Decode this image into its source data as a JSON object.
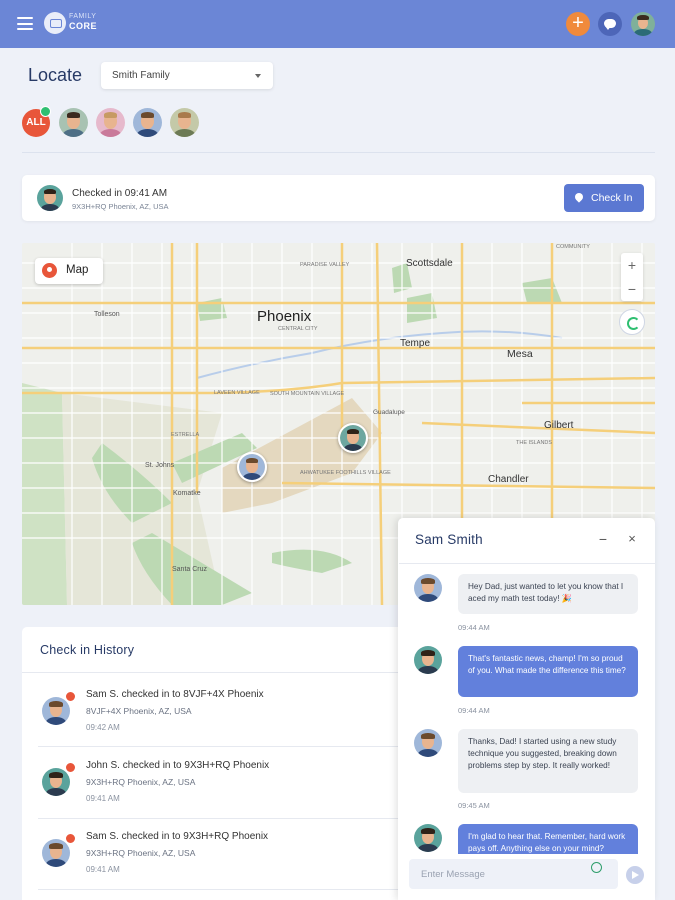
{
  "app": {
    "logo_line1": "FAMILY",
    "logo_line2": "CORE",
    "accent_color": "#6b86d6"
  },
  "header": {
    "menu_icon": "hamburger-icon",
    "plus_symbol": "+",
    "chat_icon": "chat-bubble-icon"
  },
  "locate": {
    "title": "Locate",
    "selected_family": "Smith Family",
    "all_label": "ALL"
  },
  "checkin": {
    "title": "Checked in 09:41 AM",
    "address": "9X3H+RQ Phoenix, AZ, USA",
    "button_label": "Check In"
  },
  "map": {
    "chip_label": "Map",
    "zoom_in": "+",
    "zoom_out": "−",
    "labels": {
      "phoenix": "Phoenix",
      "scottsdale": "Scottsdale",
      "tempe": "Tempe",
      "mesa": "Mesa",
      "gilbert": "Gilbert",
      "chandler": "Chandler",
      "tolleson": "Tolleson",
      "st_johns": "St. Johns",
      "komatke": "Komatke",
      "santa_cruz": "Santa Cruz",
      "guadalupe": "Guadalupe",
      "central_city": "CENTRAL CITY",
      "community": "COMMUNITY",
      "paradise_valley": "PARADISE VALLEY",
      "estrella": "ESTRELLA",
      "laveen": "LAVEEN VILLAGE",
      "south_mountain": "SOUTH MOUNTAIN VILLAGE",
      "the_islands": "THE ISLANDS",
      "ahwatukee": "AHWATUKEE FOOTHILLS VILLAGE"
    }
  },
  "history": {
    "title": "Check in History",
    "items": [
      {
        "title": "Sam S. checked in to 8VJF+4X Phoenix",
        "address": "8VJF+4X Phoenix, AZ, USA",
        "time": "09:42 AM"
      },
      {
        "title": "John S. checked in to 9X3H+RQ Phoenix",
        "address": "9X3H+RQ Phoenix, AZ, USA",
        "time": "09:41 AM"
      },
      {
        "title": "Sam S. checked in to 9X3H+RQ Phoenix",
        "address": "9X3H+RQ Phoenix, AZ, USA",
        "time": "09:41 AM"
      }
    ]
  },
  "chat": {
    "name": "Sam Smith",
    "minimize": "−",
    "close": "×",
    "messages": [
      {
        "direction": "in",
        "text": "Hey Dad, just wanted to let you know that I aced my math test today! 🎉",
        "time": "09:44 AM"
      },
      {
        "direction": "out",
        "text": "That's fantastic news, champ! I'm so proud of you. What made the difference this time?",
        "time": "09:44 AM"
      },
      {
        "direction": "in",
        "text": "Thanks, Dad! I started using a new study technique you suggested, breaking down problems step by step. It really worked!",
        "time": "09:45 AM"
      },
      {
        "direction": "out",
        "text": "I'm glad to hear that. Remember, hard work pays off. Anything else on your mind?",
        "time": ""
      }
    ],
    "input_placeholder": "Enter Message",
    "send_icon": "send-icon",
    "emoji_icon": "emoji-icon"
  }
}
